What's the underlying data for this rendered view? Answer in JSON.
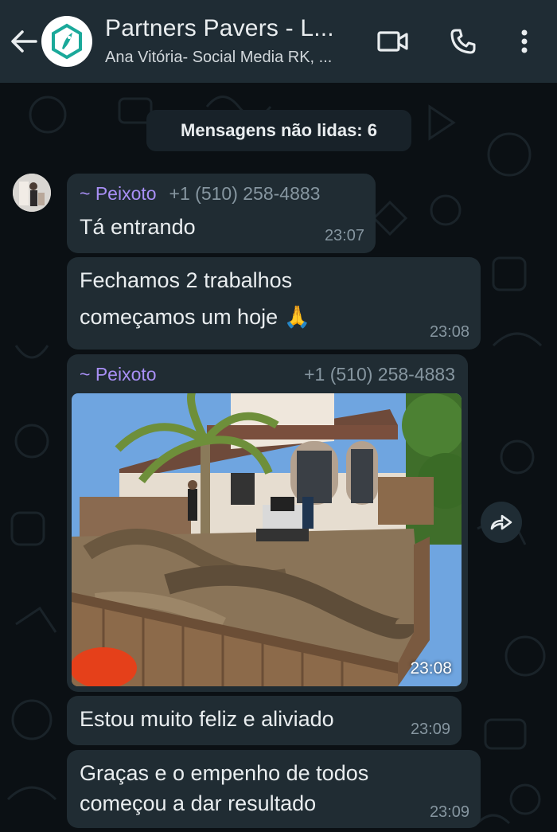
{
  "header": {
    "title": "Partners Pavers - L...",
    "subtitle": "Ana Vitória- Social Media RK, ...",
    "icons": [
      "back-arrow-icon",
      "video-call-icon",
      "phone-icon",
      "more-options-icon"
    ]
  },
  "unread": {
    "label": "Mensagens não lidas: 6"
  },
  "messages": [
    {
      "sender": "~ Peixoto",
      "phone": "+1 (510) 258-4883",
      "text": "Tá entrando",
      "time": "23:07"
    },
    {
      "line1": "Fechamos 2 trabalhos",
      "line2": "começamos um hoje 🙏",
      "time": "23:08"
    },
    {
      "sender": "~ Peixoto",
      "phone": "+1 (510) 258-4883",
      "type": "image",
      "time": "23:08"
    },
    {
      "text": "Estou muito feliz e aliviado",
      "time": "23:09"
    },
    {
      "line1": "Graças e o empenho de todos",
      "line2": "começou a dar resultado",
      "time": "23:09"
    }
  ],
  "colors": {
    "header_bg": "#1f2c34",
    "chat_bg": "#0b1014",
    "bubble_bg": "#202c33",
    "sender_name": "#a88ff5",
    "meta_text": "#8696a0",
    "group_logo": "#1aa99a"
  }
}
